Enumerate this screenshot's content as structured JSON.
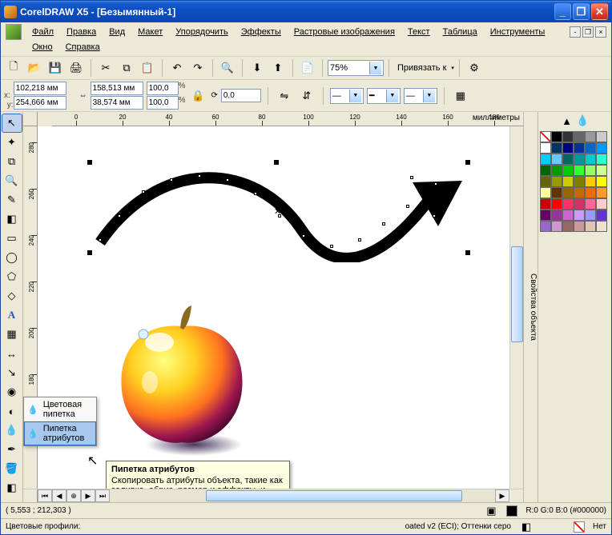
{
  "title": "CorelDRAW X5 - [Безымянный-1]",
  "menu": {
    "items": [
      "Файл",
      "Правка",
      "Вид",
      "Макет",
      "Упорядочить",
      "Эффекты",
      "Растровые изображения",
      "Текст",
      "Таблица",
      "Инструменты",
      "Окно",
      "Справка"
    ]
  },
  "toolbar1": {
    "zoom": "75%",
    "snap": "Привязать к"
  },
  "propbar": {
    "x_lbl": "x:",
    "y_lbl": "y:",
    "x": "102,218 мм",
    "y": "254,666 мм",
    "w": "158,513 мм",
    "h": "38,574 мм",
    "sx": "100,0",
    "sy": "100,0",
    "rot": "0,0"
  },
  "ruler": {
    "units": "миллиметры",
    "h_ticks": [
      0,
      20,
      40,
      60,
      80,
      100,
      120,
      140,
      160,
      180
    ],
    "v_ticks": [
      280,
      260,
      240,
      220,
      200,
      180
    ]
  },
  "flyout": {
    "items": [
      {
        "label": "Цветовая пипетка",
        "selected": false
      },
      {
        "label": "Пипетка атрибутов",
        "selected": true
      }
    ]
  },
  "tooltip": {
    "title": "Пипетка атрибутов",
    "body": "Скопировать атрибуты объекта, такие как заливка, абрис, размер и эффекты, и применить их к другим объектам."
  },
  "status": {
    "coords": "( 5,553 ; 212,303 )",
    "profiles_lbl": "Цветовые профили:",
    "profiles_tail": "oated v2 (ECI); Оттенки серо",
    "fill": "R:0 G:0 B:0 (#000000)",
    "outline": "Нет"
  },
  "docker": {
    "title": "Свойства объекта"
  },
  "palette_colors": [
    [
      "nocolor",
      "#000000",
      "#333333",
      "#666666",
      "#999999",
      "#cccccc"
    ],
    [
      "#ffffff",
      "#003366",
      "#000080",
      "#003399",
      "#0066cc",
      "#0099ff"
    ],
    [
      "#00ccff",
      "#66ccff",
      "#006666",
      "#009999",
      "#00cccc",
      "#33ffcc"
    ],
    [
      "#006600",
      "#009900",
      "#00cc00",
      "#33ff33",
      "#99ff66",
      "#ccff99"
    ],
    [
      "#666600",
      "#999900",
      "#cccc00",
      "#808000",
      "#ffcc00",
      "#ffff00"
    ],
    [
      "#ffff99",
      "#663300",
      "#996600",
      "#cc6600",
      "#ff6600",
      "#ff9933"
    ],
    [
      "#cc0000",
      "#ff0000",
      "#ff3366",
      "#cc3366",
      "#ff6699",
      "#ffcccc"
    ],
    [
      "#660066",
      "#993399",
      "#cc66cc",
      "#cc99ff",
      "#9999ff",
      "#6633cc"
    ],
    [
      "#9966cc",
      "#cc99cc",
      "#996666",
      "#cc9999",
      "#e0c8b0",
      "#f0e0d0"
    ]
  ]
}
